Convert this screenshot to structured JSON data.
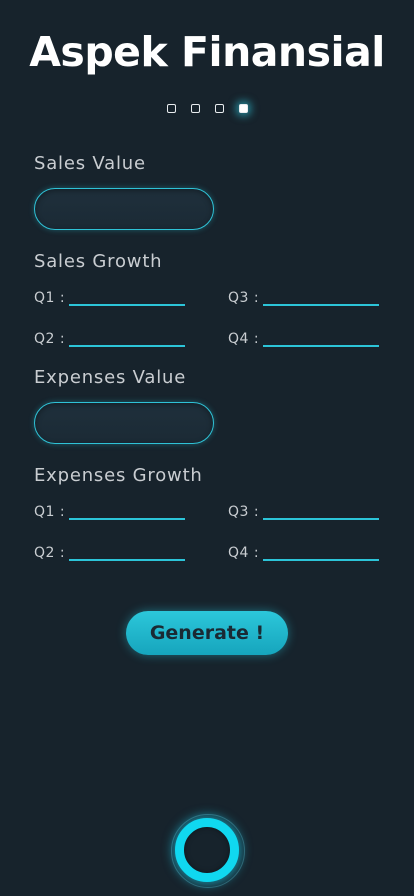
{
  "app": {
    "title": "Aspek Finansial"
  },
  "pager": {
    "count": 4,
    "active_index": 3
  },
  "sales": {
    "value_label": "Sales Value",
    "value": "",
    "growth_label": "Sales Growth",
    "quarters": [
      {
        "label": "Q1 :",
        "value": ""
      },
      {
        "label": "Q3 :",
        "value": ""
      },
      {
        "label": "Q2 :",
        "value": ""
      },
      {
        "label": "Q4 :",
        "value": ""
      }
    ]
  },
  "expenses": {
    "value_label": "Expenses Value",
    "value": "",
    "growth_label": "Expenses Growth",
    "quarters": [
      {
        "label": "Q1 :",
        "value": ""
      },
      {
        "label": "Q3 :",
        "value": ""
      },
      {
        "label": "Q2 :",
        "value": ""
      },
      {
        "label": "Q4 :",
        "value": ""
      }
    ]
  },
  "actions": {
    "generate_label": "Generate !"
  },
  "nav": {
    "home_icon": "ring-home-icon",
    "accent": "#10d8f0"
  },
  "colors": {
    "background": "#17232c",
    "accent": "#2cc4d8",
    "title": "#ffffff"
  }
}
